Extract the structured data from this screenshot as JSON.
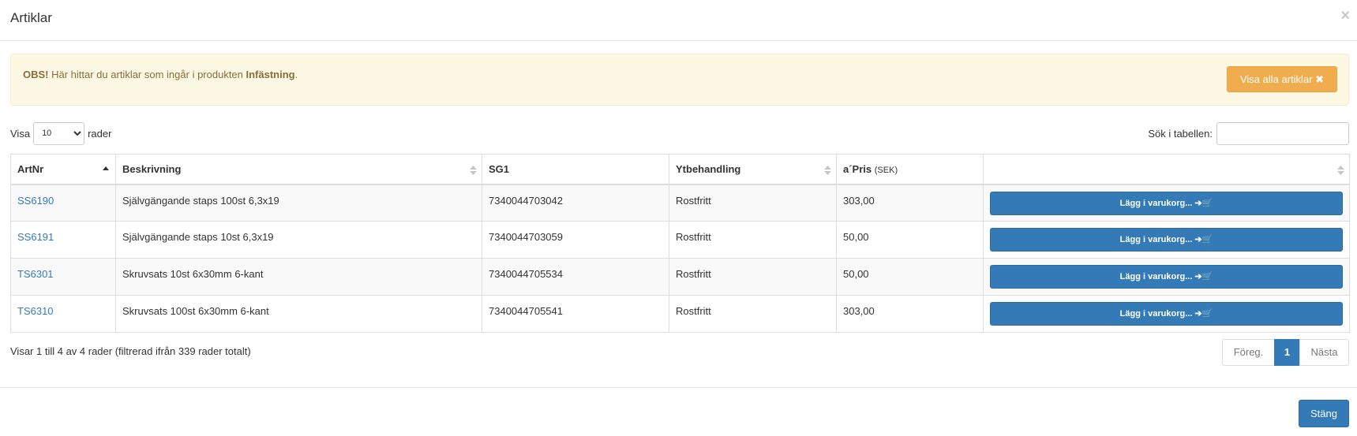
{
  "modal": {
    "title": "Artiklar",
    "close_symbol": "×"
  },
  "alert": {
    "strong": "OBS!",
    "text": " Här hittar du artiklar som ingår i produkten ",
    "product": "Infästning",
    "end": ".",
    "button_label": "Visa alla artiklar ✖"
  },
  "length": {
    "prefix": "Visa",
    "value": "10",
    "suffix": "rader"
  },
  "search": {
    "label": "Sök i tabellen:",
    "value": ""
  },
  "table": {
    "headers": [
      "ArtNr",
      "Beskrivning",
      "SG1",
      "Ytbehandling",
      "a´Pris",
      "(SEK)"
    ],
    "cart_label": "Lägg i varukorg... ➔🛒",
    "rows": [
      {
        "artnr": "SS6190",
        "beskrivning": "Självgängande staps 100st 6,3x19",
        "sg1": "7340044703042",
        "yt": "Rostfritt",
        "pris": "303,00"
      },
      {
        "artnr": "SS6191",
        "beskrivning": "Självgängande staps 10st 6,3x19",
        "sg1": "7340044703059",
        "yt": "Rostfritt",
        "pris": "50,00"
      },
      {
        "artnr": "TS6301",
        "beskrivning": "Skruvsats 10st 6x30mm 6-kant",
        "sg1": "7340044705534",
        "yt": "Rostfritt",
        "pris": "50,00"
      },
      {
        "artnr": "TS6310",
        "beskrivning": "Skruvsats 100st 6x30mm 6-kant",
        "sg1": "7340044705541",
        "yt": "Rostfritt",
        "pris": "303,00"
      }
    ]
  },
  "info": "Visar 1 till 4 av 4 rader (filtrerad ifrån 339 rader totalt)",
  "pagination": {
    "prev": "Föreg.",
    "current": "1",
    "next": "Nästa"
  },
  "footer": {
    "close_label": "Stäng"
  },
  "colors": {
    "primary": "#337ab7",
    "warning": "#f0ad4e",
    "alert_bg": "#fcf8e3",
    "alert_text": "#8a6d3b"
  }
}
